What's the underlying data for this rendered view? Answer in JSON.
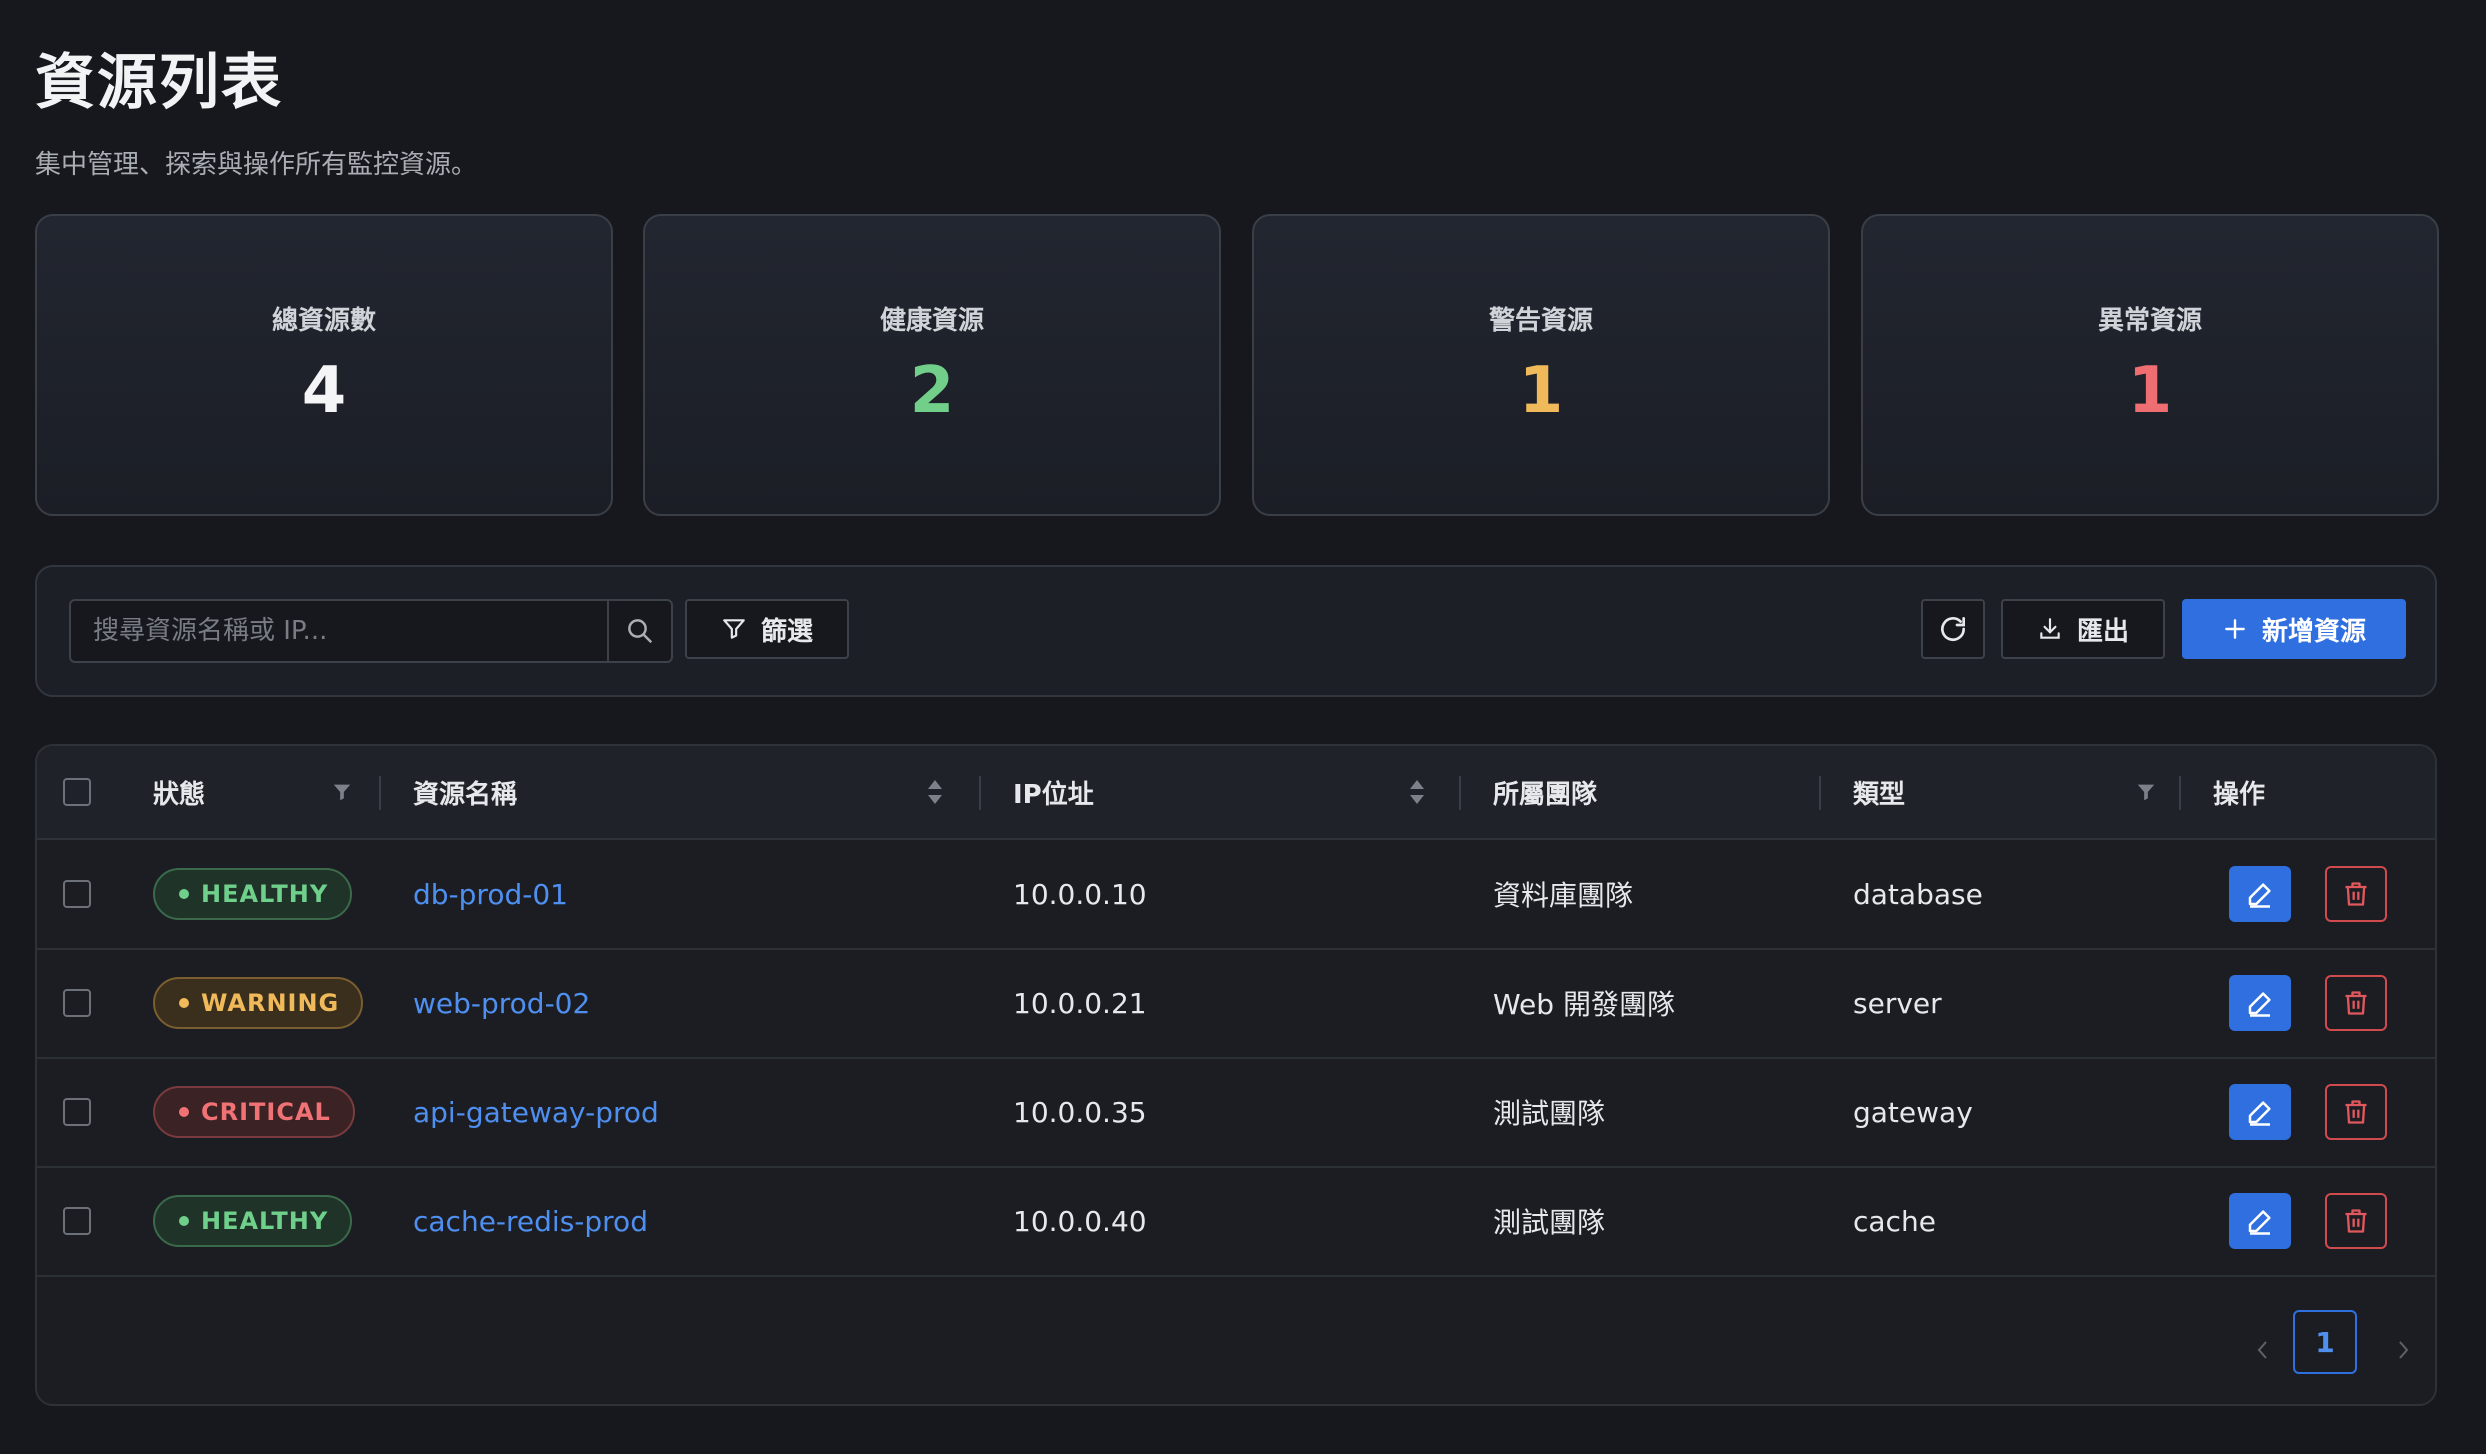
{
  "header": {
    "title": "資源列表",
    "subtitle": "集中管理、探索與操作所有監控資源。"
  },
  "stats": [
    {
      "label": "總資源數",
      "value": "4",
      "color": "#f4f5f7"
    },
    {
      "label": "健康資源",
      "value": "2",
      "color": "#72cf8a"
    },
    {
      "label": "警告資源",
      "value": "1",
      "color": "#f0b95a"
    },
    {
      "label": "異常資源",
      "value": "1",
      "color": "#ee6e72"
    }
  ],
  "toolbar": {
    "search_placeholder": "搜尋資源名稱或 IP...",
    "filter_label": "篩選",
    "export_label": "匯出",
    "add_label": "新增資源"
  },
  "table": {
    "columns": {
      "status": "狀態",
      "name": "資源名稱",
      "ip": "IP位址",
      "team": "所屬團隊",
      "type": "類型",
      "actions": "操作"
    },
    "rows": [
      {
        "status": "HEALTHY",
        "status_kind": "healthy",
        "name": "db-prod-01",
        "ip": "10.0.0.10",
        "team": "資料庫團隊",
        "type": "database"
      },
      {
        "status": "WARNING",
        "status_kind": "warning",
        "name": "web-prod-02",
        "ip": "10.0.0.21",
        "team": "Web 開發團隊",
        "type": "server"
      },
      {
        "status": "CRITICAL",
        "status_kind": "critical",
        "name": "api-gateway-prod",
        "ip": "10.0.0.35",
        "team": "測試團隊",
        "type": "gateway"
      },
      {
        "status": "HEALTHY",
        "status_kind": "healthy",
        "name": "cache-redis-prod",
        "ip": "10.0.0.40",
        "team": "測試團隊",
        "type": "cache"
      }
    ]
  },
  "pagination": {
    "current_page": "1"
  },
  "icons": {
    "search": "search-icon",
    "filter": "filter-icon",
    "refresh": "refresh-icon",
    "export": "download-icon",
    "add": "plus-icon",
    "edit": "pencil-icon",
    "delete": "trash-icon",
    "sort": "sort-icon",
    "column_filter": "funnel-icon"
  },
  "colors": {
    "accent": "#2f6fe0",
    "link": "#4f8ff0",
    "healthy": "#6fd08b",
    "warning": "#f0b95a",
    "critical": "#f07275"
  }
}
